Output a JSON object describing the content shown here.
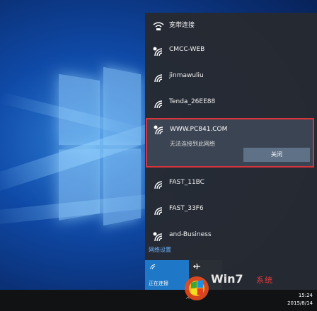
{
  "network_panel": {
    "networks": [
      {
        "name": "宽带连接",
        "icon": "broadband-icon"
      },
      {
        "name": "CMCC-WEB",
        "icon": "wifi-open-icon"
      },
      {
        "name": "jinmawuliu",
        "icon": "wifi-icon"
      },
      {
        "name": "Tenda_26EE88",
        "icon": "wifi-icon"
      }
    ],
    "selected": {
      "name": "WWW.PC841.COM",
      "status": "无法连接到此网络",
      "button": "关闭",
      "icon": "wifi-open-icon"
    },
    "networks_below": [
      {
        "name": "FAST_11BC",
        "icon": "wifi-icon"
      },
      {
        "name": "FAST_33F6",
        "icon": "wifi-icon"
      },
      {
        "name": "and-Business",
        "icon": "wifi-open-icon"
      }
    ],
    "settings_label": "网络设置",
    "tiles": [
      {
        "label": "正在连接",
        "icon": "wifi-tile-icon"
      },
      {
        "label": "",
        "icon": "airplane-icon"
      }
    ]
  },
  "taskbar": {
    "time": "15:24",
    "date": "2015/8/14"
  },
  "colors": {
    "accent": "#1f77c7",
    "highlight_border": "#d8343b",
    "link": "#6fb7ff"
  }
}
